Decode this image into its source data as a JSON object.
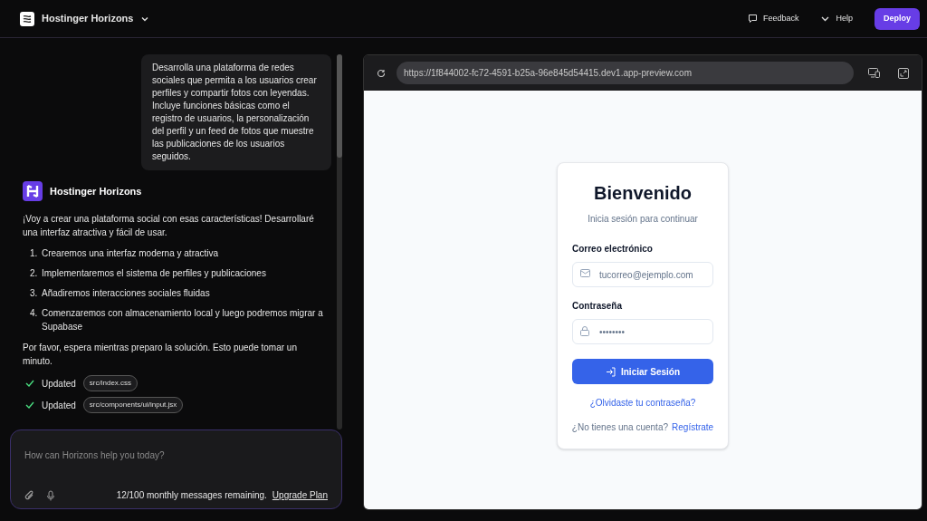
{
  "header": {
    "product": "Hostinger Horizons",
    "actions": [
      {
        "kind": "feedback",
        "label": "Feedback"
      },
      {
        "kind": "help",
        "label": "Help"
      }
    ],
    "deploy": "Deploy"
  },
  "chat": {
    "user_message": "Desarrolla una plataforma de redes sociales que permita a los usuarios crear perfiles y compartir fotos con leyendas. Incluye funciones básicas como el registro de usuarios, la personalización del perfil y un feed de fotos que muestre las publicaciones de los usuarios seguidos.",
    "assistant_name": "Hostinger Horizons",
    "intro": "¡Voy a crear una plataforma social con esas características! Desarrollaré una interfaz atractiva y fácil de usar.",
    "steps": [
      {
        "number": "1.",
        "text": "Crearemos una interfaz moderna y atractiva"
      },
      {
        "number": "2.",
        "text": "Implementaremos el sistema de perfiles y publicaciones"
      },
      {
        "number": "3.",
        "text": "Añadiremos interacciones sociales fluidas"
      },
      {
        "number": "4.",
        "text": "Comenzaremos con almacenamiento local y luego podremos migrar a Supabase"
      }
    ],
    "outro": "Por favor, espera mientras preparo la solución. Esto puede tomar un minuto.",
    "updates": [
      {
        "label": "Updated",
        "file": "src/index.css"
      },
      {
        "label": "Updated",
        "file": "src/components/ui/input.jsx"
      }
    ]
  },
  "composer": {
    "placeholder": "How can Horizons help you today?",
    "quota": "12/100 monthly messages remaining.",
    "upgrade": "Upgrade Plan"
  },
  "preview": {
    "url": "https://1f844002-fc72-4591-b25a-96e845d54415.dev1.app-preview.com",
    "login": {
      "title": "Bienvenido",
      "subtitle": "Inicia sesión para continuar",
      "fields": [
        {
          "kind": "email",
          "label": "Correo electrónico",
          "placeholder": "tucorreo@ejemplo.com"
        },
        {
          "kind": "password",
          "label": "Contraseña",
          "placeholder": "••••••••"
        }
      ],
      "submit": "Iniciar Sesión",
      "forgot": "¿Olvidaste tu contraseña?",
      "signup_prompt": "¿No tienes una cuenta?",
      "signup_link": "Regístrate"
    }
  }
}
